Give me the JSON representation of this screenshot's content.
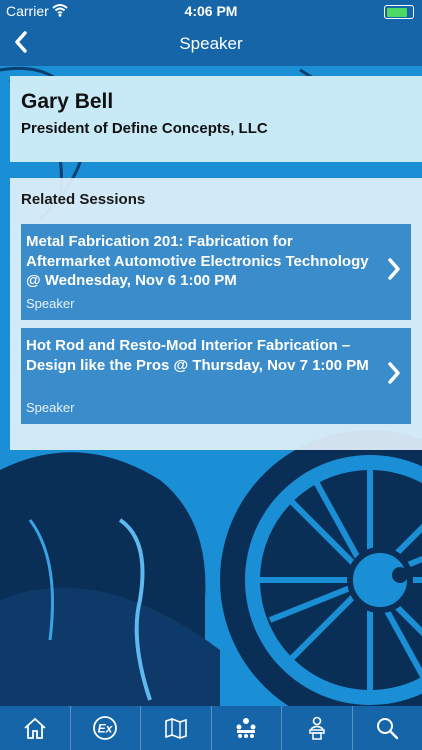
{
  "status_bar": {
    "carrier": "Carrier",
    "time": "4:06 PM",
    "battery_level": 0.9
  },
  "nav": {
    "title": "Speaker",
    "back_icon": "chevron-left-icon"
  },
  "speaker": {
    "name": "Gary Bell",
    "title": "President of Define Concepts, LLC"
  },
  "related": {
    "heading": "Related Sessions",
    "sessions": [
      {
        "title": "Metal Fabrication 201: Fabrication for Aftermarket Automotive Electronics Technology @ Wednesday, Nov 6 1:00 PM",
        "role": "Speaker"
      },
      {
        "title": "Hot Rod and Resto-Mod Interior Fabrication – Design like the Pros @ Thursday, Nov 7 1:00 PM",
        "role": "Speaker"
      }
    ]
  },
  "tabs": [
    {
      "icon": "home-icon"
    },
    {
      "icon": "exhibitors-icon"
    },
    {
      "icon": "map-icon"
    },
    {
      "icon": "sessions-icon"
    },
    {
      "icon": "speaker-icon"
    },
    {
      "icon": "search-icon"
    }
  ],
  "colors": {
    "primary": "#1565a8",
    "accent": "#3b8ccb",
    "background": "#1a8fd6"
  }
}
